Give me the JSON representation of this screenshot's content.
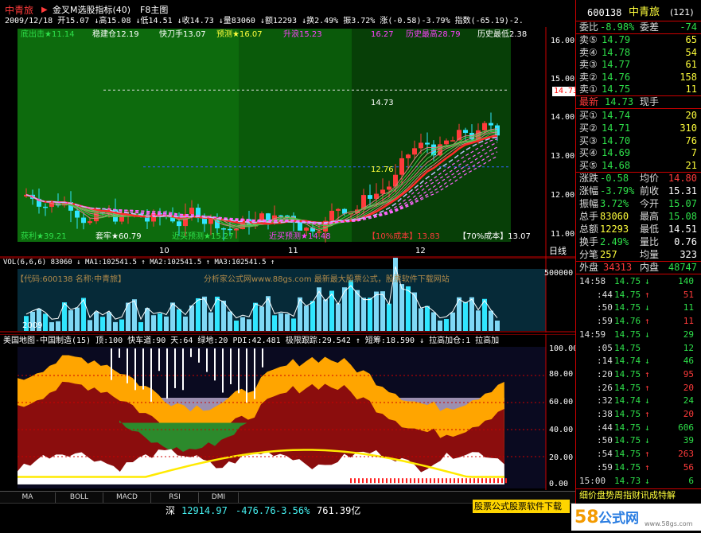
{
  "header": {
    "stock_name": "中青旅",
    "indicator": "金叉M选股指标(40)",
    "chart_label": "F8主图",
    "quote_line": "2009/12/18 开15.07 ↓高15.08 ↓低14.51 ↓收14.73 ↓量83060 ↓额12293 ↓换2.49% 振3.72% 涨(-0.58)-3.79% 指数(-65.19)-2."
  },
  "main_chart": {
    "labels_top": [
      "底出击★11.14",
      "稳建仓12.19",
      "快刀手13.07",
      "预测★16.07",
      "升浪15.23",
      "16.27",
      "历史最高28.79",
      "历史最低2.38"
    ],
    "labels_bottom": [
      "获利★39.21",
      "套牢★60.79",
      "近买预测★15.27",
      "近买预测★14.48",
      "【10%成本】13.83",
      "【70%成本】13.07"
    ],
    "price_marker": "14.73",
    "level_upper": "14.73",
    "level_lower": "12.76",
    "y_ticks": [
      "16.00",
      "15.00",
      "14.00",
      "13.00",
      "12.00",
      "11.00"
    ],
    "x_ticks": [
      "10",
      "11",
      "12"
    ],
    "x_end_label": "日线",
    "colors": {
      "up": "#ff3b3b",
      "down": "#30e6ff",
      "bg_green": "#0f6a0f"
    }
  },
  "volume_chart": {
    "header": "VOL(6,6,6) 83060 ↓ MA1:102541.5 ↑ MA2:102541.5 ↑ MA3:102541.5 ↑",
    "watermark_left": "【代码:600138 名称:中青旅】",
    "watermark_mid": "分析家公式网www.88gs.com 最新最大股票公式，股票软件下载网站",
    "y_tick": "500000",
    "x_start": "2009"
  },
  "indicator_chart": {
    "header": "美国地图-中国制造(15) 顶:100 快车道:90 天:64 绿地:20 PDI:42.481 极限跟踪:29.542 ↑ 短筹:18.590 ↓ 拉高加仓:1 拉高加",
    "y_ticks": [
      "100.00",
      "80.00",
      "60.00",
      "40.00",
      "20.00",
      "0.00"
    ]
  },
  "tabs": [
    "MA",
    "BOLL",
    "MACD",
    "RSI",
    "DMI"
  ],
  "status": {
    "index_name": "深",
    "index_value": "12914.97",
    "change": "-476.76",
    "change_pct": "-3.56%",
    "amount": "761.39亿"
  },
  "banner_text": "股票公式股票软件下载",
  "right_panel": {
    "code": "600138",
    "name": "中青旅",
    "suffix": "(121)",
    "weibi_label": "委比",
    "weibi": "-8.98%",
    "weicha_label": "委差",
    "weicha": "-74",
    "asks": [
      {
        "label": "卖⑤",
        "price": "14.79",
        "vol": "65"
      },
      {
        "label": "卖④",
        "price": "14.78",
        "vol": "54"
      },
      {
        "label": "卖③",
        "price": "14.77",
        "vol": "61"
      },
      {
        "label": "卖②",
        "price": "14.76",
        "vol": "158"
      },
      {
        "label": "卖①",
        "price": "14.75",
        "vol": "11"
      }
    ],
    "latest_label": "最新",
    "latest": "14.73",
    "xianshou_label": "现手",
    "bids": [
      {
        "label": "买①",
        "price": "14.74",
        "vol": "20"
      },
      {
        "label": "买②",
        "price": "14.71",
        "vol": "310"
      },
      {
        "label": "买③",
        "price": "14.70",
        "vol": "76"
      },
      {
        "label": "买④",
        "price": "14.69",
        "vol": "7"
      },
      {
        "label": "买⑤",
        "price": "14.68",
        "vol": "21"
      }
    ],
    "stats": [
      {
        "l1": "涨跌",
        "v1": "-0.58",
        "l2": "均价",
        "v2": "14.80"
      },
      {
        "l1": "涨幅",
        "v1": "-3.79%",
        "l2": "前收",
        "v2": "15.31"
      },
      {
        "l1": "振幅",
        "v1": "3.72%",
        "l2": "今开",
        "v2": "15.07"
      },
      {
        "l1": "总手",
        "v1": "83060",
        "l2": "最高",
        "v2": "15.08"
      },
      {
        "l1": "总额",
        "v1": "12293",
        "l2": "最低",
        "v2": "14.51"
      },
      {
        "l1": "换手",
        "v1": "2.49%",
        "l2": "量比",
        "v2": "0.76"
      },
      {
        "l1": "分笔",
        "v1": "257",
        "l2": "均量",
        "v2": "323"
      }
    ],
    "waipan_label": "外盘",
    "waipan": "34313",
    "neipan_label": "内盘",
    "neipan": "48747",
    "ticks": [
      {
        "time": "14:58",
        "price": "14.75",
        "arrow": "↓",
        "vol": "140"
      },
      {
        "time": ":44",
        "price": "14.75",
        "arrow": "↑",
        "vol": "51"
      },
      {
        "time": ":50",
        "price": "14.75",
        "arrow": "↓",
        "vol": "11"
      },
      {
        "time": ":59",
        "price": "14.76",
        "arrow": "↑",
        "vol": "11"
      },
      {
        "time": "14:59",
        "price": "14.75",
        "arrow": "↓",
        "vol": "29"
      },
      {
        "time": ":05",
        "price": "14.75",
        "arrow": "",
        "vol": "12"
      },
      {
        "time": ":14",
        "price": "14.74",
        "arrow": "↓",
        "vol": "46"
      },
      {
        "time": ":20",
        "price": "14.75",
        "arrow": "↑",
        "vol": "95"
      },
      {
        "time": ":26",
        "price": "14.75",
        "arrow": "↑",
        "vol": "20"
      },
      {
        "time": ":32",
        "price": "14.74",
        "arrow": "↓",
        "vol": "24"
      },
      {
        "time": ":38",
        "price": "14.75",
        "arrow": "↑",
        "vol": "20"
      },
      {
        "time": ":44",
        "price": "14.75",
        "arrow": "↓",
        "vol": "606"
      },
      {
        "time": ":50",
        "price": "14.75",
        "arrow": "↓",
        "vol": "39"
      },
      {
        "time": ":54",
        "price": "14.75",
        "arrow": "↑",
        "vol": "263"
      },
      {
        "time": ":59",
        "price": "14.75",
        "arrow": "↑",
        "vol": "56"
      },
      {
        "time": "15:00",
        "price": "14.73",
        "arrow": "↓",
        "vol": "6"
      }
    ],
    "footer": "细价盘势周指财讯成特解"
  }
}
